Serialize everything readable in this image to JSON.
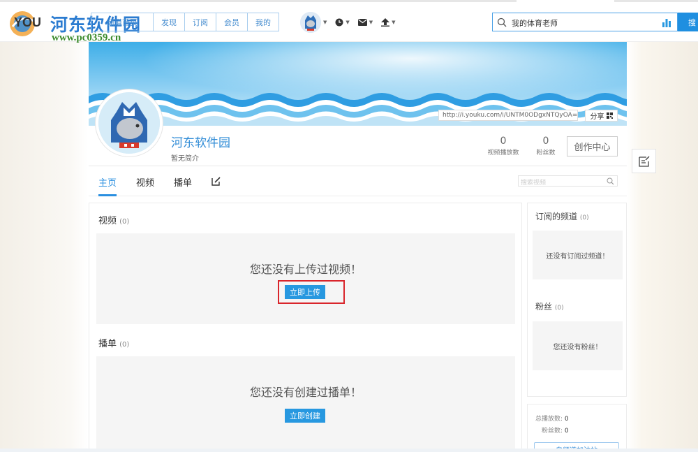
{
  "logo": {
    "brand_text": "河东软件园",
    "brand_url": "www.pc0359.cn",
    "yk_fragment": "YOU"
  },
  "nav": {
    "links": [
      "频道首页",
      "发现",
      "订阅",
      "会员",
      "我的"
    ]
  },
  "search": {
    "value": "我的体育老师",
    "button_label": "搜"
  },
  "profile": {
    "url": "http://i.youku.com/i/UNTM0ODgxNTQyOA==",
    "share_label": "分享",
    "name": "河东软件园",
    "bio": "暂无简介",
    "play_count": "0",
    "play_count_label": "视频播放数",
    "fans_count": "0",
    "fans_count_label": "粉丝数",
    "create_center_label": "创作中心"
  },
  "tabs": {
    "home": "主页",
    "videos": "视频",
    "playlists": "播单",
    "search_placeholder": "搜索视频"
  },
  "main": {
    "videos_title": "视频",
    "videos_count": "(0)",
    "videos_empty": "您还没有上传过视频！",
    "upload_button": "立即上传",
    "playlists_title": "播单",
    "playlists_count": "(0)",
    "playlists_empty": "您还没有创建过播单！",
    "create_button": "立即创建"
  },
  "side": {
    "subs_title": "订阅的频道",
    "subs_count": "(0)",
    "subs_empty": "还没有订阅过频道！",
    "fans_title": "粉丝",
    "fans_count": "(0)",
    "fans_empty": "您还没有粉丝！",
    "total_plays_label": "总播放数:",
    "total_plays_value": "0",
    "fans_label": "粉丝数:",
    "fans_value": "0",
    "bottom_button": "自频道加油站"
  },
  "colors": {
    "accent": "#2798e0",
    "highlight_frame": "#d9252b",
    "link_blue": "#2f8bd6"
  },
  "icons": [
    "search-icon",
    "bar-chart-icon",
    "clock-icon",
    "mail-icon",
    "upload-icon",
    "edit-icon",
    "feedback-icon",
    "qr-code-icon"
  ]
}
